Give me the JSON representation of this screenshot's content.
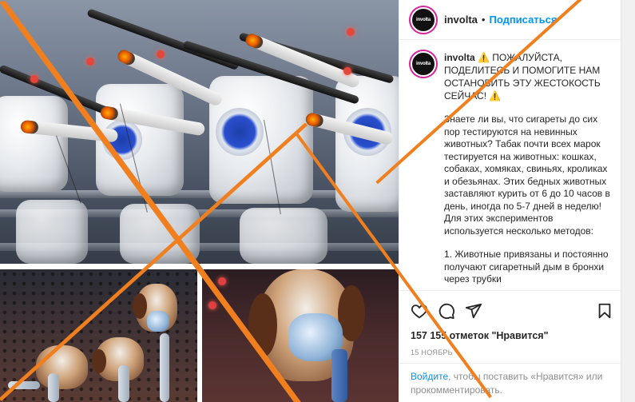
{
  "header": {
    "avatar_text": "involta",
    "username": "involta",
    "separator": "•",
    "follow_label": "Подписаться"
  },
  "caption": {
    "username": "involta",
    "headline": "⚠️ ПОЖАЛУЙСТА, ПОДЕЛИТЕСЬ И ПОМОГИТЕ НАМ ОСТАНОВИТЬ ЭТУ ЖЕСТОКОСТЬ СЕЙЧАС! ⚠️",
    "paragraph_1": "Знаете ли вы, что сигареты до сих пор тестируются на невинных животных? Табак почти всех марок тестируется на животных: кошках, собаках, хомяках, свиньях, кроликах и обезьянах. Этих бедных животных заставляют курить от 6 до 10 часов в день, иногда по 5-7 дней в неделю! Для этих экспериментов используется несколько методов:",
    "paragraph_2": "1. Животные привязаны и постоянно получают сигаретный дым в бронхи через трубки"
  },
  "actions": {
    "like_icon": "heart-icon",
    "comment_icon": "comment-icon",
    "share_icon": "share-icon",
    "save_icon": "bookmark-icon"
  },
  "likes_text": "157 155 отметок \"Нравится\"",
  "date_text": "15 ноябрь",
  "login_prompt": {
    "link": "Войдите",
    "rest": ", чтобы поставить «Нравится» или прокомментировать."
  },
  "colors": {
    "cross_out": "#f07f1f",
    "link_blue": "#0095f6",
    "avatar_ring": "#d6249f"
  }
}
